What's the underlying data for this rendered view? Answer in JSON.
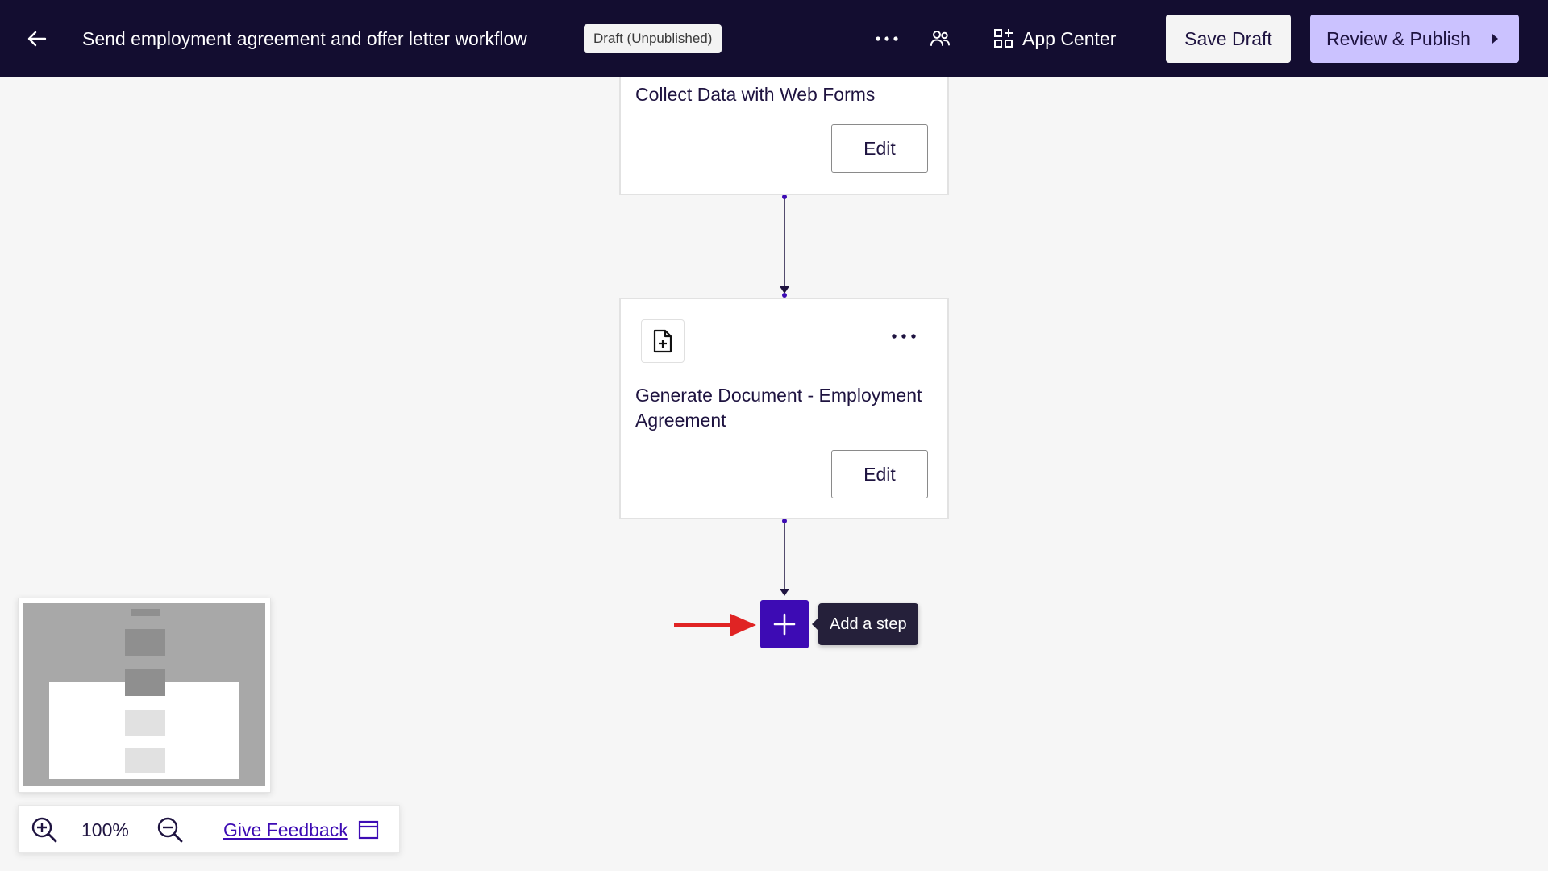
{
  "header": {
    "workflow_title": "Send employment agreement and offer letter workflow",
    "status_badge": "Draft (Unpublished)",
    "app_center_label": "App Center",
    "save_draft_label": "Save Draft",
    "review_publish_label": "Review & Publish"
  },
  "steps": [
    {
      "title": "Collect Data with Web Forms",
      "edit_label": "Edit",
      "icon": "form-icon"
    },
    {
      "title": "Generate Document - Employment Agreement",
      "edit_label": "Edit",
      "icon": "document-add-icon"
    }
  ],
  "add_step": {
    "tooltip": "Add a step"
  },
  "zoom": {
    "level": "100%",
    "feedback_label": "Give Feedback"
  },
  "colors": {
    "topbar": "#130d30",
    "accent": "#3d0bb4",
    "publish_button": "#cbc2ff",
    "annotation_arrow": "#e02424"
  }
}
